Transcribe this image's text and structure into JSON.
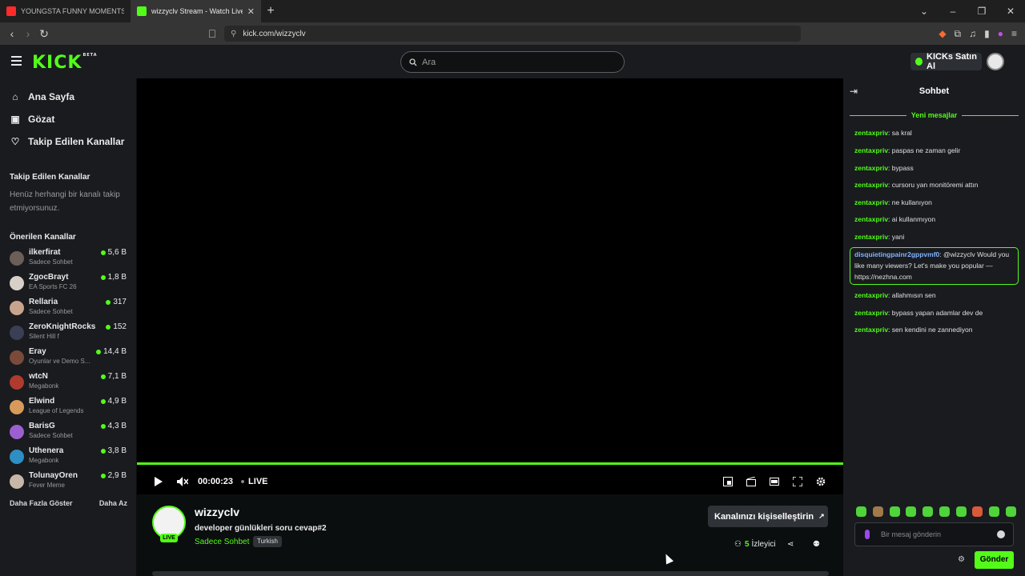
{
  "browser": {
    "tabs": [
      {
        "title": "YOUNGSTA FUNNY MOMENTS #you",
        "active": false
      },
      {
        "title": "wizzyclv Stream - Watch Live on",
        "active": true
      }
    ],
    "url": "kick.com/wizzyclv"
  },
  "header": {
    "logo": "KICK",
    "logo_badge": "BETA",
    "search_placeholder": "Ara",
    "kicks_button": "KICKs Satın Al"
  },
  "sidebar": {
    "nav": [
      {
        "label": "Ana Sayfa",
        "icon": "home-icon"
      },
      {
        "label": "Gözat",
        "icon": "browse-icon"
      },
      {
        "label": "Takip Edilen Kanallar",
        "icon": "heart-icon"
      }
    ],
    "followed_title": "Takip Edilen Kanallar",
    "followed_empty": "Henüz herhangi bir kanalı takip etmiyorsunuz.",
    "recommended_title": "Önerilen Kanallar",
    "channels": [
      {
        "name": "ilkerfirat",
        "category": "Sadece Sohbet",
        "viewers": "5,6 B"
      },
      {
        "name": "ZgocBrayt",
        "category": "EA Sports FC 26",
        "viewers": "1,8 B"
      },
      {
        "name": "Rellaria",
        "category": "Sadece Sohbet",
        "viewers": "317"
      },
      {
        "name": "ZeroKnightRocks",
        "category": "Silent Hill f",
        "viewers": "152"
      },
      {
        "name": "Eray",
        "category": "Oyunlar ve Demo S...",
        "viewers": "14,4 B"
      },
      {
        "name": "wtcN",
        "category": "Megabonk",
        "viewers": "7,1 B"
      },
      {
        "name": "Elwind",
        "category": "League of Legends",
        "viewers": "4,9 B"
      },
      {
        "name": "BarisG",
        "category": "Sadece Sohbet",
        "viewers": "4,3 B"
      },
      {
        "name": "Uthenera",
        "category": "Megabonk",
        "viewers": "3,8 B"
      },
      {
        "name": "TolunayOren",
        "category": "Fever Meme",
        "viewers": "2,9 B"
      }
    ],
    "show_more": "Daha Fazla Göster",
    "show_less": "Daha Az"
  },
  "player": {
    "time": "00:00:23",
    "live_label": "LIVE",
    "progress": 1.0
  },
  "stream": {
    "streamer": "wizzyclv",
    "live_badge": "LIVE",
    "title": "developer günlükleri soru cevap#2",
    "category": "Sadece Sohbet",
    "tag": "Turkish",
    "customize_button": "Kanalınızı kişiselleştirin",
    "viewer_count": "5",
    "viewer_label": "İzleyici"
  },
  "chat": {
    "title": "Sohbet",
    "new_messages": "Yeni mesajlar",
    "messages": [
      {
        "user": "zentaxpriv",
        "text": "sa kral"
      },
      {
        "user": "zentaxpriv",
        "text": "paspas ne zaman gelir"
      },
      {
        "user": "zentaxpriv",
        "text": "bypass"
      },
      {
        "user": "zentaxpriv",
        "text": "cursoru yan monitöremi attın"
      },
      {
        "user": "zentaxpriv",
        "text": "ne kullanıyon"
      },
      {
        "user": "zentaxpriv",
        "text": "ai kullanmıyon"
      },
      {
        "user": "zentaxpriv",
        "text": "yani"
      },
      {
        "user": "disquietingpainr2gppvmf0",
        "text": "@wizzyclv Would you like many viewers? Let's make you popular — https://nezhna.com"
      },
      {
        "user": "zentaxpriv",
        "text": "allahmısın sen"
      },
      {
        "user": "zentaxpriv",
        "text": "bypass yapan adamlar dev de"
      },
      {
        "user": "zentaxpriv",
        "text": "sen kendini ne zannediyon"
      }
    ],
    "input_placeholder": "Bir mesaj gönderin",
    "send_button": "Gönder"
  },
  "colors": {
    "accent": "#53fc18",
    "background": "#0b0e0f",
    "panel": "#191b1f"
  }
}
